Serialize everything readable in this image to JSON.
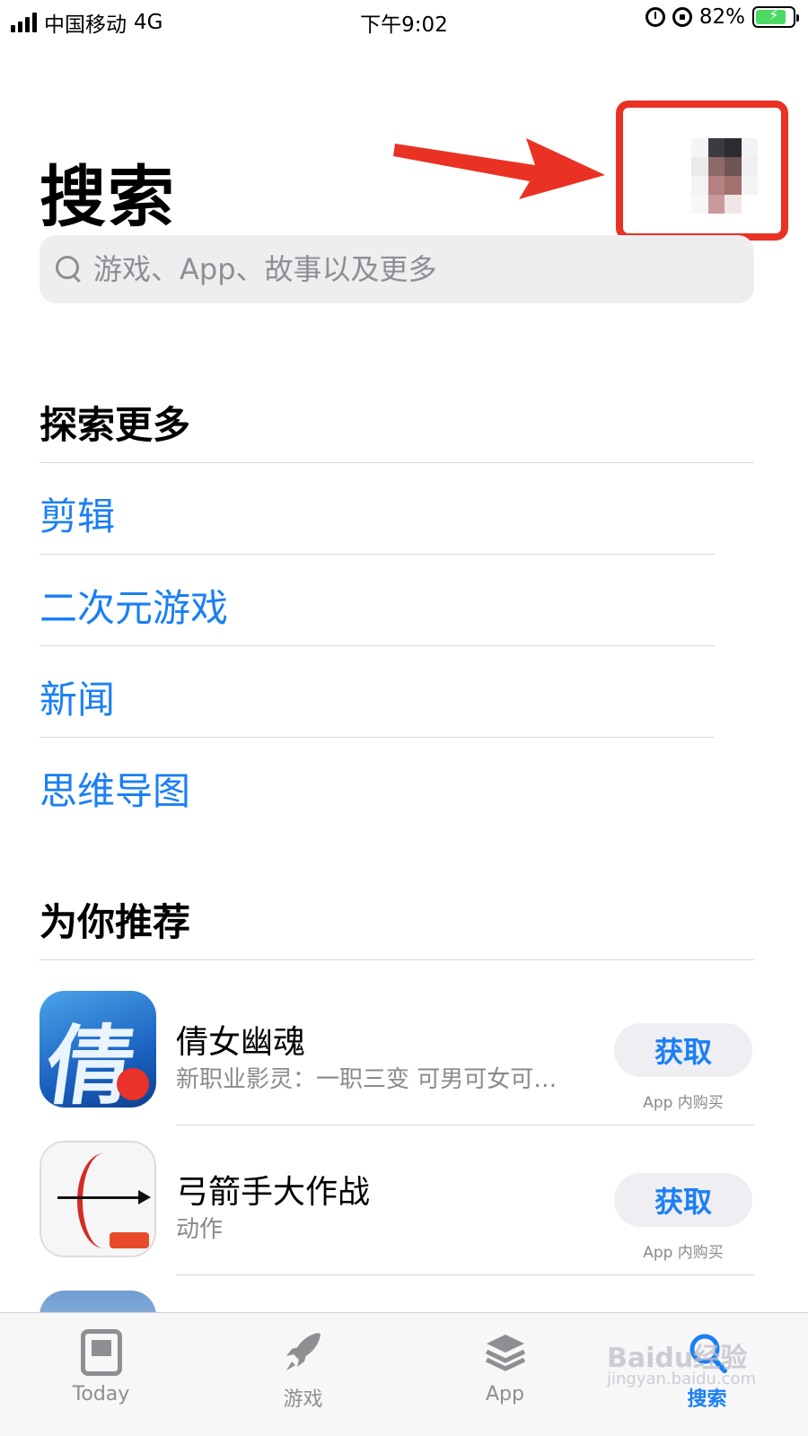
{
  "status_bar": {
    "carrier": "中国移动",
    "network": "4G",
    "time": "下午9:02",
    "battery_percent": "82%",
    "signal_bars": 4,
    "battery_level": 0.82,
    "battery_color": "#4cd964"
  },
  "header": {
    "title": "搜索",
    "avatar_icon": "avatar",
    "highlight_color": "#e93223"
  },
  "search": {
    "placeholder": "游戏、App、故事以及更多",
    "value": ""
  },
  "explore": {
    "title": "探索更多",
    "items": [
      {
        "label": "剪辑"
      },
      {
        "label": "二次元游戏"
      },
      {
        "label": "新闻"
      },
      {
        "label": "思维导图"
      }
    ]
  },
  "recommended": {
    "title": "为你推荐",
    "apps": [
      {
        "name": "倩女幽魂",
        "subtitle": "新职业影灵：一职三变 可男可女可…",
        "action": "获取",
        "note": "App 内购买",
        "icon_text": "倩"
      },
      {
        "name": "弓箭手大作战",
        "subtitle": "动作",
        "action": "获取",
        "note": "App 内购买",
        "icon_text": ""
      }
    ]
  },
  "tab_bar": {
    "tabs": [
      {
        "label": "Today",
        "icon": "today-icon",
        "active": false
      },
      {
        "label": "游戏",
        "icon": "rocket-icon",
        "active": false
      },
      {
        "label": "App",
        "icon": "stack-icon",
        "active": false
      },
      {
        "label": "搜索",
        "icon": "search-icon",
        "active": true
      }
    ]
  },
  "watermark": {
    "brand": "Baidu经验",
    "url": "jingyan.baidu.com"
  },
  "colors": {
    "accent": "#1a7ff5",
    "annotation": "#e93223"
  }
}
